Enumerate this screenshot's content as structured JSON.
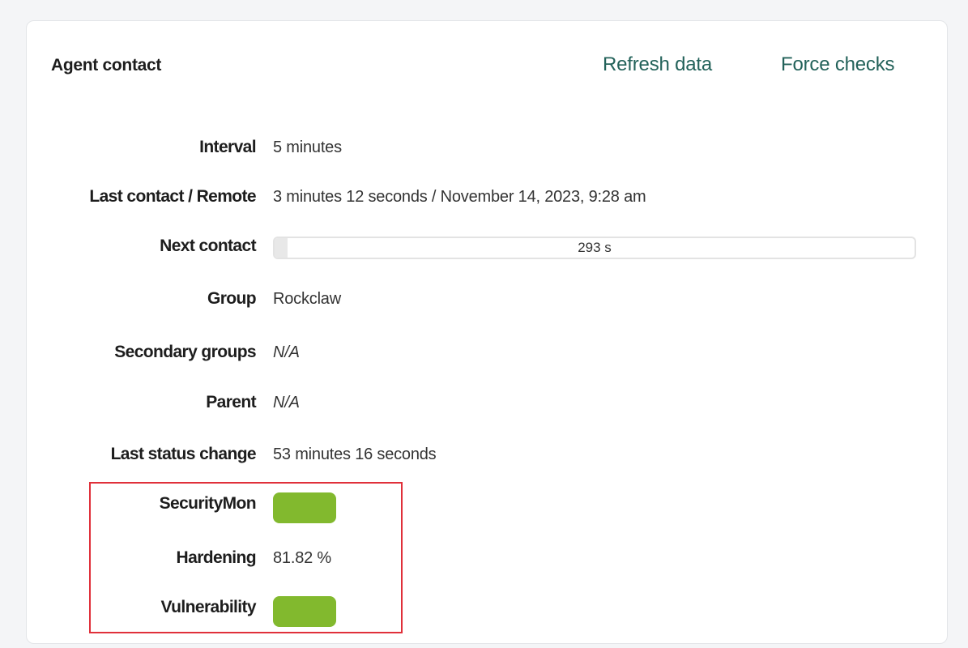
{
  "panel": {
    "title": "Agent contact",
    "actions": {
      "refresh_label": "Refresh data",
      "force_label": "Force checks"
    }
  },
  "rows": {
    "interval": {
      "label": "Interval",
      "value": "5 minutes"
    },
    "last_contact": {
      "label": "Last contact / Remote",
      "value": "3 minutes 12 seconds / November 14, 2023, 9:28 am"
    },
    "next_contact": {
      "label": "Next contact",
      "progress_text": "293 s",
      "progress_fraction": 0.02
    },
    "group": {
      "label": "Group",
      "value": "Rockclaw"
    },
    "secondary_groups": {
      "label": "Secondary groups",
      "value": "N/A"
    },
    "parent": {
      "label": "Parent",
      "value": "N/A"
    },
    "last_status_change": {
      "label": "Last status change",
      "value": "53 minutes 16 seconds"
    },
    "securitymon": {
      "label": "SecurityMon",
      "status": "ok",
      "color": "#82b92e"
    },
    "hardening": {
      "label": "Hardening",
      "value": "81.82 %"
    },
    "vulnerability": {
      "label": "Vulnerability",
      "status": "ok",
      "color": "#82b92e"
    }
  },
  "colors": {
    "link": "#23625a",
    "ok_status": "#82b92e",
    "highlight": "#e0303a"
  }
}
